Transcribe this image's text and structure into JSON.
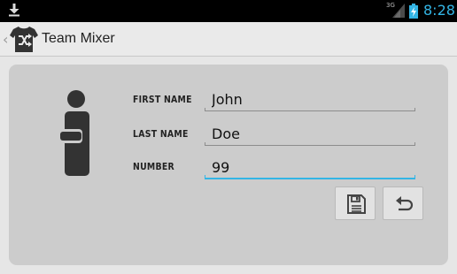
{
  "status_bar": {
    "network": "3G",
    "time": "8:28",
    "download_icon": "download-icon",
    "signal_icon": "signal-icon",
    "battery_icon": "battery-charging-icon"
  },
  "action_bar": {
    "title": "Team Mixer",
    "up_icon": "chevron-left-icon",
    "logo_icon": "jersey-shuffle-icon"
  },
  "form": {
    "avatar_icon": "person-icon",
    "fields": {
      "first_name": {
        "label": "FIRST NAME",
        "value": "John"
      },
      "last_name": {
        "label": "LAST NAME",
        "value": "Doe"
      },
      "number": {
        "label": "NUMBER",
        "value": "99"
      }
    },
    "buttons": {
      "save_icon": "floppy-disk-icon",
      "undo_icon": "undo-icon"
    }
  },
  "colors": {
    "accent": "#33b5e5",
    "status_bar_bg": "#000000",
    "card_bg": "#cccccc",
    "icon_dark": "#333333"
  }
}
